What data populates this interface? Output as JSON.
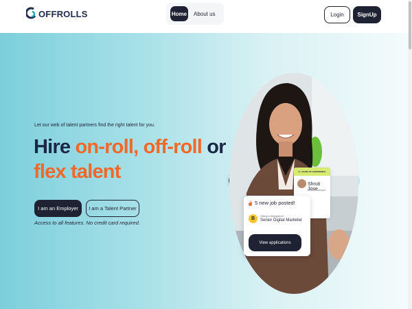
{
  "header": {
    "logo_text": "OFFROLLS",
    "nav": {
      "home": "Home",
      "about": "About us"
    },
    "login": "Login",
    "signup": "SignUp"
  },
  "hero": {
    "tagline": "Let our web of talent partners find the right talent for you.",
    "headline": {
      "part1": "Hire ",
      "part2": "on-roll, off-roll",
      "part3": " or",
      "part4": "flex talent"
    },
    "employer_button": "I am an Employer",
    "partner_button": "I am a Talent Partner",
    "access_note": "Access to all features. No credit card required."
  },
  "job_card": {
    "jobs_posted": "5 new job posted!",
    "company_initial": "B",
    "hiring_in": "Hiring in Bangalore",
    "job_title": "Senior Digital Marketer",
    "view_button": "View applications"
  },
  "profile_card": {
    "experience": "6+ YEARS OF EXPERIENCE",
    "name": "Shruti Jose",
    "role": "UI/UX Developer"
  },
  "colors": {
    "navy": "#1a2746",
    "dark_button": "#1f2233",
    "accent_orange": "#f0692b",
    "hero_gradient_start": "#7ccfdc",
    "hero_gradient_end": "#f4fbfc",
    "logo_teal": "#1fa3b5"
  },
  "icons": [
    "logo-mark-icon",
    "fire-icon"
  ]
}
